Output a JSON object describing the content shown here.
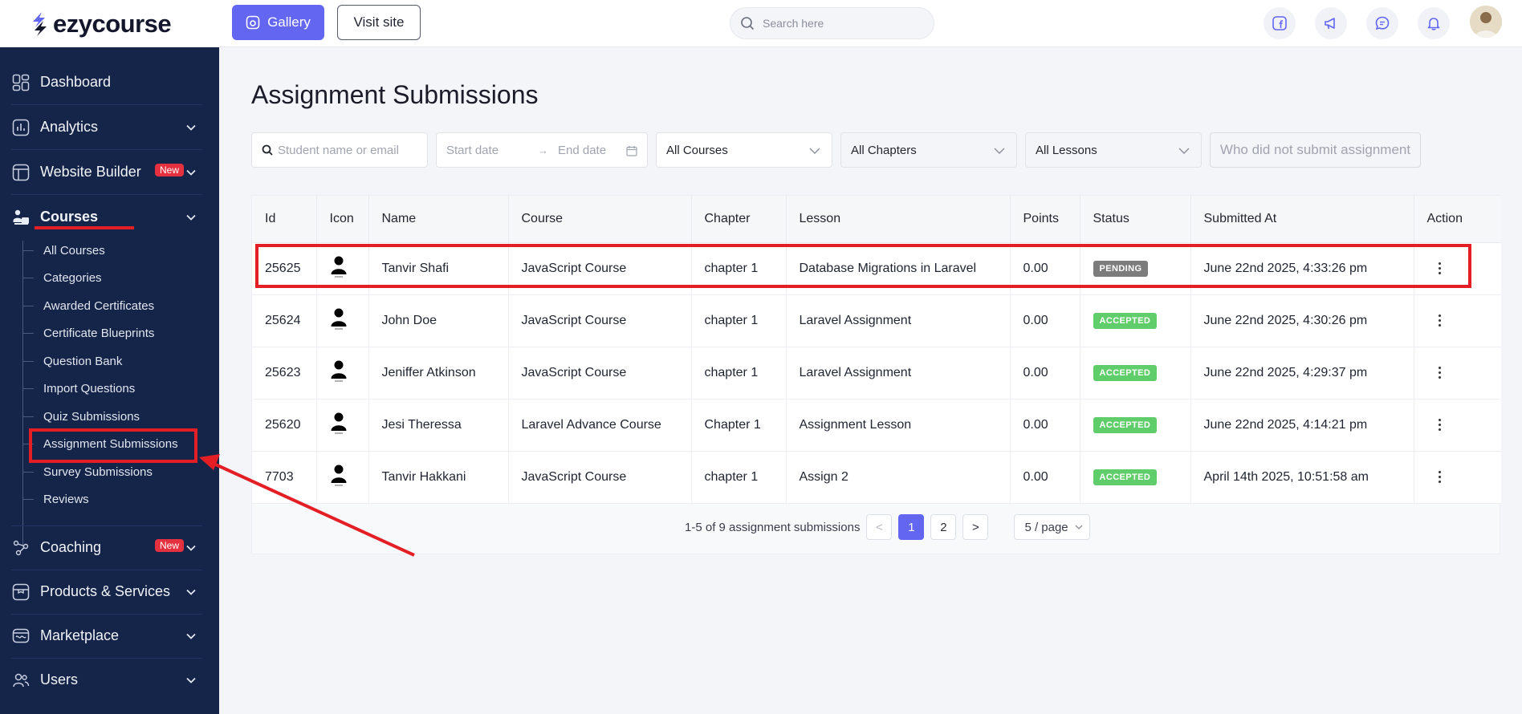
{
  "brand": {
    "name": "ezycourse",
    "accent": "#6266f1"
  },
  "topbar": {
    "gallery_label": "Gallery",
    "visit_label": "Visit site",
    "search_placeholder": "Search here",
    "icons": [
      "facebook-icon",
      "megaphone-icon",
      "chat-icon",
      "bell-icon"
    ]
  },
  "sidebar": {
    "items": [
      {
        "label": "Dashboard",
        "icon": "dashboard-icon"
      },
      {
        "label": "Analytics",
        "icon": "analytics-icon"
      },
      {
        "label": "Website Builder",
        "icon": "website-icon",
        "badge": "New"
      },
      {
        "label": "Courses",
        "icon": "courses-icon"
      },
      {
        "label": "Coaching",
        "icon": "coaching-icon",
        "badge": "New"
      },
      {
        "label": "Products & Services",
        "icon": "products-icon"
      },
      {
        "label": "Marketplace",
        "icon": "marketplace-icon"
      },
      {
        "label": "Users",
        "icon": "users-icon"
      }
    ],
    "course_sub_items": [
      "All Courses",
      "Categories",
      "Awarded Certificates",
      "Certificate Blueprints",
      "Question Bank",
      "Import Questions",
      "Quiz Submissions",
      "Assignment Submissions",
      "Survey Submissions",
      "Reviews"
    ]
  },
  "main": {
    "title": "Assignment Submissions",
    "filters": {
      "student_placeholder": "Student name or email",
      "start_date_placeholder": "Start date",
      "end_date_placeholder": "End date",
      "courses": "All Courses",
      "chapters": "All Chapters",
      "lessons": "All Lessons",
      "not_submitted_label": "Who did not submit assignment"
    },
    "table": {
      "columns": [
        "Id",
        "Icon",
        "Name",
        "Course",
        "Chapter",
        "Lesson",
        "Points",
        "Status",
        "Submitted At",
        "Action"
      ],
      "rows": [
        {
          "id": "25625",
          "name": "Tanvir Shafi",
          "course": "JavaScript Course",
          "chapter": "chapter 1",
          "lesson": "Database Migrations in Laravel",
          "points": "0.00",
          "status": "PENDING",
          "submitted_at": "June 22nd 2025, 4:33:26 pm"
        },
        {
          "id": "25624",
          "name": "John Doe",
          "course": "JavaScript Course",
          "chapter": "chapter 1",
          "lesson": "Laravel Assignment",
          "points": "0.00",
          "status": "ACCEPTED",
          "submitted_at": "June 22nd 2025, 4:30:26 pm"
        },
        {
          "id": "25623",
          "name": "Jeniffer Atkinson",
          "course": "JavaScript Course",
          "chapter": "chapter 1",
          "lesson": "Laravel Assignment",
          "points": "0.00",
          "status": "ACCEPTED",
          "submitted_at": "June 22nd 2025, 4:29:37 pm"
        },
        {
          "id": "25620",
          "name": "Jesi Theressa",
          "course": "Laravel Advance Course",
          "chapter": "Chapter 1",
          "lesson": "Assignment Lesson",
          "points": "0.00",
          "status": "ACCEPTED",
          "submitted_at": "June 22nd 2025, 4:14:21 pm"
        },
        {
          "id": "7703",
          "name": "Tanvir Hakkani",
          "course": "JavaScript Course",
          "chapter": "chapter 1",
          "lesson": "Assign 2",
          "points": "0.00",
          "status": "ACCEPTED",
          "submitted_at": "April 14th 2025, 10:51:58 am"
        }
      ]
    },
    "pagination": {
      "summary": "1-5 of 9 assignment submissions",
      "prev": "<",
      "pages": [
        "1",
        "2"
      ],
      "next": ">",
      "page_size": "5 / page"
    }
  },
  "colors": {
    "sidebar_bg": "#152549",
    "pending": "#7c7c7c",
    "accepted": "#5fce6a",
    "annotation": "#e31e24"
  }
}
